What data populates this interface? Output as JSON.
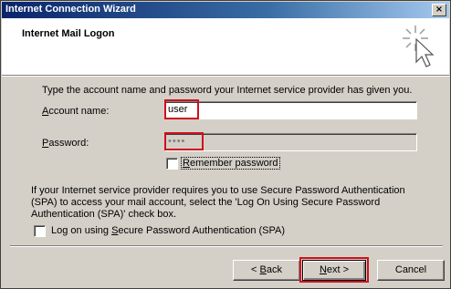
{
  "window": {
    "title": "Internet Connection Wizard",
    "close_glyph": "×"
  },
  "header": {
    "title": "Internet Mail Logon",
    "icon": "wizard-cursor-sparkle-icon"
  },
  "form": {
    "instructions": "Type the account name and password your Internet service provider has given you.",
    "account_label_mn": "A",
    "account_label_rest": "ccount name:",
    "account_value": "user",
    "password_label_mn": "P",
    "password_label_rest": "assword:",
    "password_value": "••••",
    "remember_label_mn": "R",
    "remember_label_rest": "emember password",
    "remember_checked": false
  },
  "spa": {
    "text_line1": "If your Internet service provider requires you to use Secure Password Authentication",
    "text_line2": "(SPA) to access your mail account, select the 'Log On Using Secure Password",
    "text_line3": "Authentication (SPA)' check box.",
    "checkbox_label_pre": "Log on using ",
    "checkbox_label_mn": "S",
    "checkbox_label_post": "ecure Password Authentication (SPA)",
    "checked": false
  },
  "buttons": {
    "back_prefix": "< ",
    "back_mn": "B",
    "back_rest": "ack",
    "next_mn": "N",
    "next_rest": "ext >",
    "cancel": "Cancel"
  },
  "colors": {
    "highlight": "#d0101c",
    "titlebar": "#0a246a"
  }
}
